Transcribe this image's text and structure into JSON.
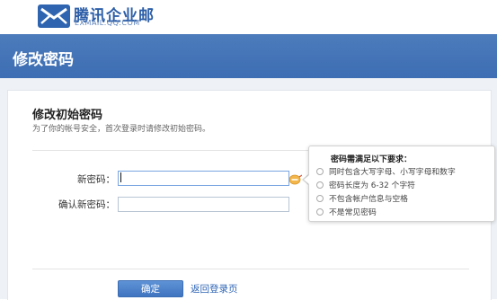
{
  "brand": {
    "name_cn": "腾讯企业邮",
    "domain": "EXMAIL.QQ.COM"
  },
  "header": {
    "title": "修改密码"
  },
  "panel": {
    "title": "修改初始密码",
    "subtitle": "为了你的帐号安全，首次登录时请修改初始密码。"
  },
  "form": {
    "new_password_label": "新密码：",
    "new_password_value": "",
    "confirm_password_label": "确认新密码：",
    "confirm_password_value": ""
  },
  "requirements": {
    "title": "密码需满足以下要求：",
    "items": [
      "同时包含大写字母、小写字母和数字",
      "密码长度为 6-32 个字符",
      "不包含帐户信息与空格",
      "不是常见密码"
    ]
  },
  "actions": {
    "confirm_label": "确定",
    "back_label": "返回登录页"
  },
  "colors": {
    "header_band": "#4d7cbc",
    "primary_button": "#4a7ec8",
    "link": "#2d64b4"
  }
}
